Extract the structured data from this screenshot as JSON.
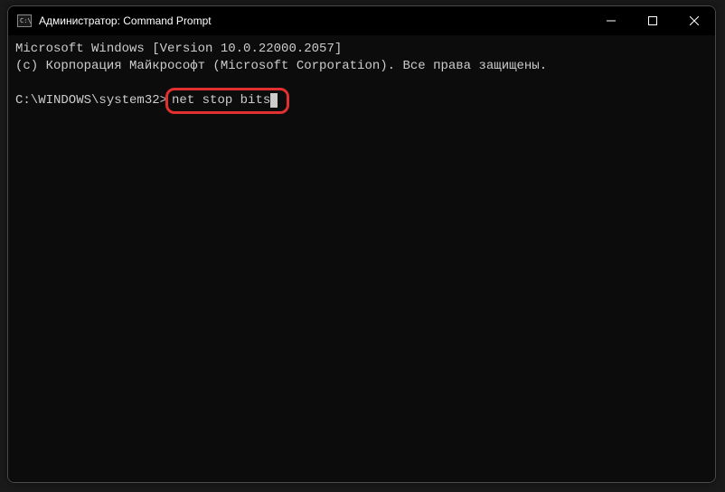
{
  "window": {
    "title": "Администратор: Command Prompt"
  },
  "terminal": {
    "line1": "Microsoft Windows [Version 10.0.22000.2057]",
    "line2": "(c) Корпорация Майкрософт (Microsoft Corporation). Все права защищены.",
    "prompt": "C:\\WINDOWS\\system32>",
    "command": "net stop bits"
  }
}
